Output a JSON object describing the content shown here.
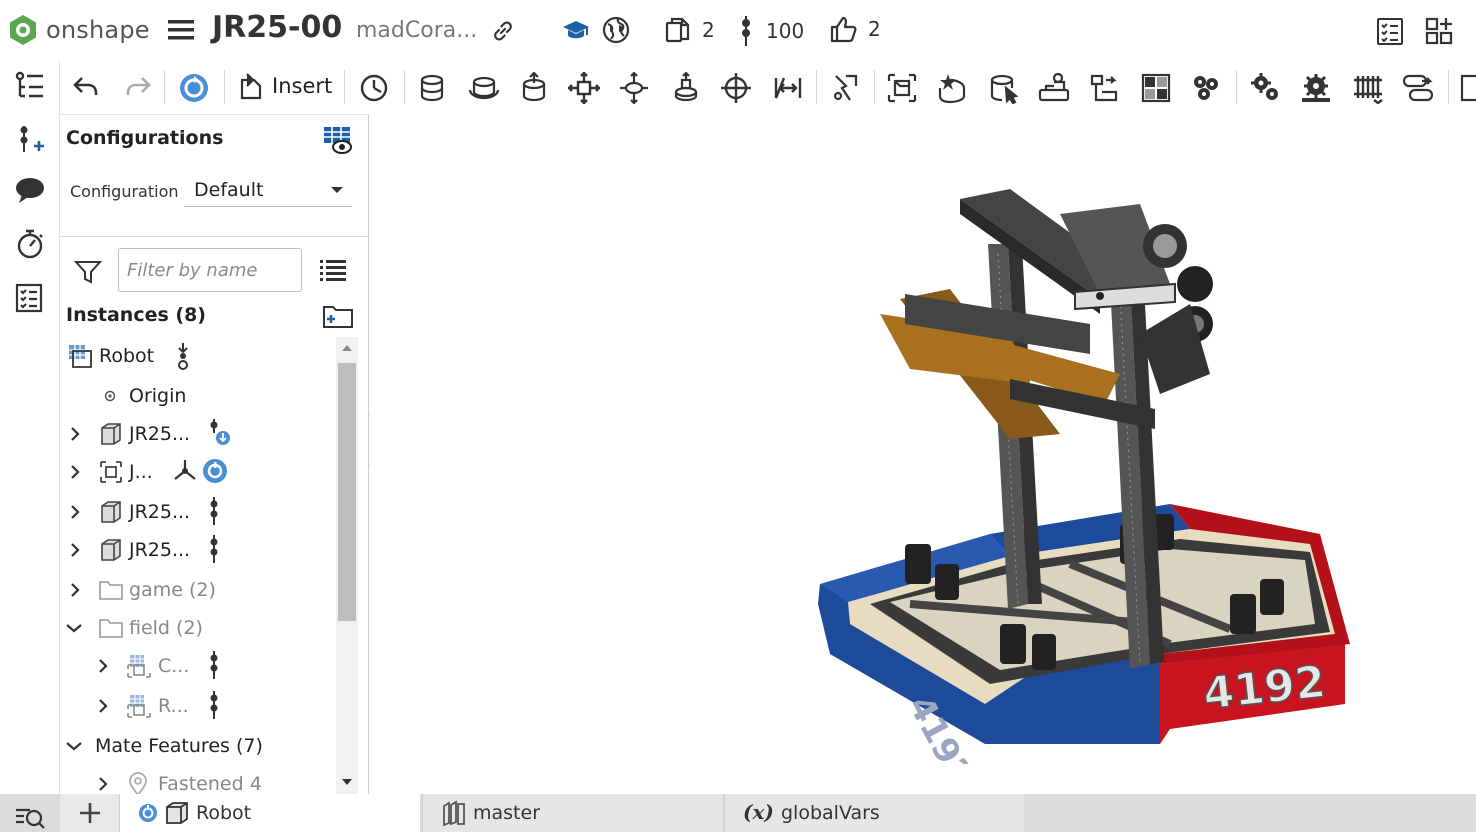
{
  "header": {
    "brand": "onshape",
    "document_title": "JR25-00",
    "owner": "madCora...",
    "copies_count": "2",
    "versions_count": "100",
    "likes_count": "2",
    "icons": [
      "onshape-logo-icon",
      "menu-icon",
      "link-icon",
      "learning-icon",
      "public-icon",
      "copies-icon",
      "versions-icon",
      "like-icon",
      "tasks-icon",
      "app-store-icon"
    ]
  },
  "toolbar": {
    "insert_label": "Insert",
    "icons": [
      "undo-icon",
      "redo-icon",
      "regenerate-icon",
      "insert-icon",
      "section-view-icon",
      "fastened-mate-icon",
      "revolute-mate-icon",
      "slider-mate-icon",
      "planar-mate-icon",
      "cylindrical-mate-icon",
      "ball-mate-icon",
      "pin-slot-mate-icon",
      "parallel-mate-icon",
      "tangent-mate-icon",
      "group-icon",
      "mate-connector-icon",
      "replicate-icon",
      "pattern-icon",
      "mirror-icon",
      "gear-relation-icon",
      "rack-pinion-icon",
      "screw-relation-icon",
      "linear-relation-icon",
      "more-icon"
    ]
  },
  "panel": {
    "configurations_title": "Configurations",
    "configuration_label": "Configuration",
    "configuration_value": "Default",
    "filter_placeholder": "Filter by name",
    "instances_title": "Instances (8)",
    "tree": [
      {
        "label": "Robot"
      },
      {
        "label": "Origin"
      },
      {
        "label": "JR25..."
      },
      {
        "label": "J..."
      },
      {
        "label": "JR25..."
      },
      {
        "label": "JR25..."
      },
      {
        "label": "game (2)"
      },
      {
        "label": "field (2)"
      },
      {
        "label": "C..."
      },
      {
        "label": "R..."
      },
      {
        "label": "Mate Features (7)"
      },
      {
        "label": "Fastened 4"
      }
    ]
  },
  "tabs": {
    "items": [
      {
        "label": "Robot"
      },
      {
        "label": "master"
      },
      {
        "label": "globalVars"
      }
    ]
  },
  "colors": {
    "accent_blue": "#1f5fa8",
    "brand_green": "#4ca54c",
    "bumper_red": "#c8141e",
    "bumper_blue": "#1e4a9a"
  }
}
